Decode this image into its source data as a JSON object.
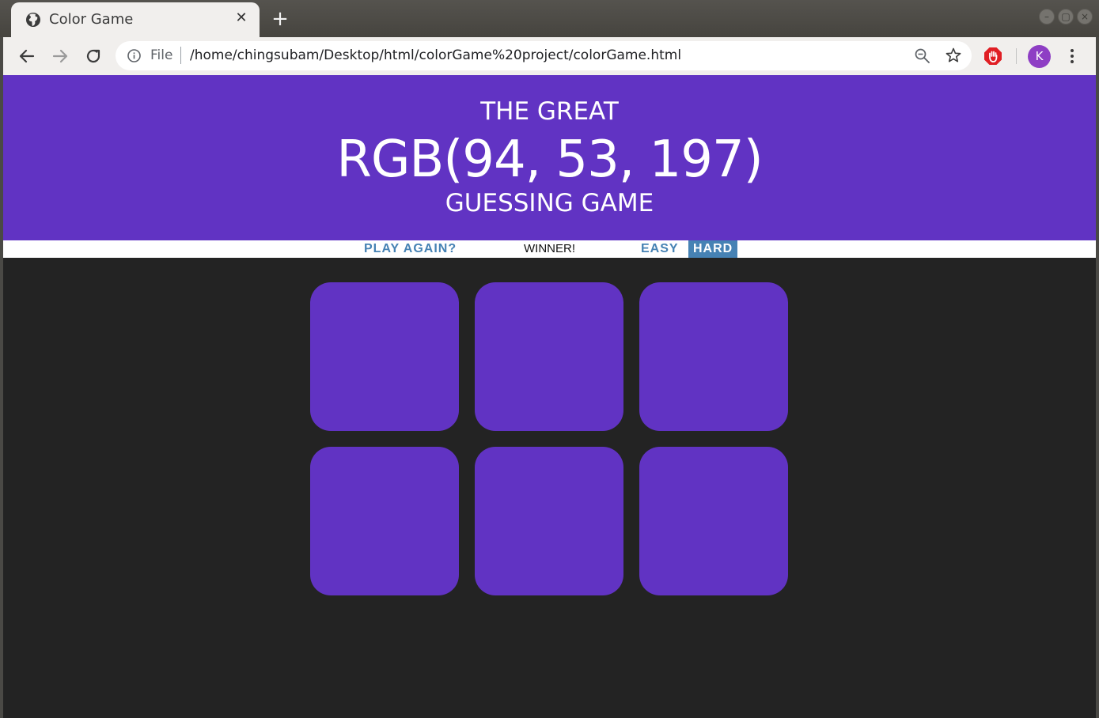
{
  "browser": {
    "tab_title": "Color Game",
    "tab_close": "✕",
    "new_tab": "+",
    "scheme_label": "File",
    "url": "/home/chingsubam/Desktop/html/colorGame%20project/colorGame.html",
    "avatar_letter": "K"
  },
  "game": {
    "title_line1": "THE GREAT",
    "rgb_display": "RGB(94, 53, 197)",
    "title_line3": "GUESSING GAME",
    "reset_label": "PLAY AGAIN?",
    "message": "WINNER!",
    "easy_label": "EASY",
    "hard_label": "HARD",
    "selected_mode": "HARD",
    "header_color": "#6133c3",
    "background_color": "#232323",
    "accent_color": "#4682b4",
    "squares": [
      "#6133c3",
      "#6133c3",
      "#6133c3",
      "#6133c3",
      "#6133c3",
      "#6133c3"
    ]
  }
}
